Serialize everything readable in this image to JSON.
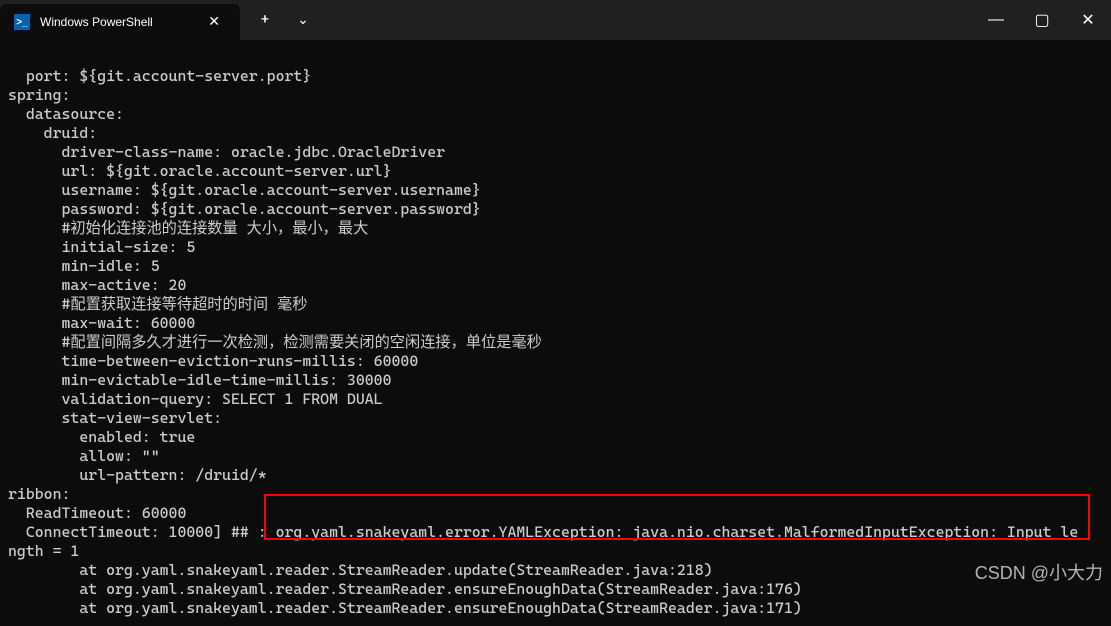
{
  "titlebar": {
    "tab_title": "Windows PowerShell",
    "tab_icon_glyph": ">_",
    "close_glyph": "✕",
    "add_glyph": "+",
    "dropdown_glyph": "⌄"
  },
  "window_controls": {
    "min": "—",
    "max": "▢",
    "close": "✕"
  },
  "terminal": {
    "lines": [
      "  port: ${git.account-server.port}",
      "spring:",
      "  datasource:",
      "    druid:",
      "      driver-class-name: oracle.jdbc.OracleDriver",
      "      url: ${git.oracle.account-server.url}",
      "      username: ${git.oracle.account-server.username}",
      "      password: ${git.oracle.account-server.password}",
      "      #初始化连接池的连接数量 大小，最小，最大",
      "      initial-size: 5",
      "      min-idle: 5",
      "      max-active: 20",
      "      #配置获取连接等待超时的时间 毫秒",
      "      max-wait: 60000",
      "      #配置间隔多久才进行一次检测，检测需要关闭的空闲连接，单位是毫秒",
      "      time-between-eviction-runs-millis: 60000",
      "      min-evictable-idle-time-millis: 30000",
      "      validation-query: SELECT 1 FROM DUAL",
      "      stat-view-servlet:",
      "        enabled: true",
      "        allow: \"\"",
      "        url-pattern: /druid/*",
      "ribbon:",
      "  ReadTimeout: 60000",
      "  ConnectTimeout: 10000] ## : org.yaml.snakeyaml.error.YAMLException: java.nio.charset.MalformedInputException: Input le",
      "ngth = 1",
      "        at org.yaml.snakeyaml.reader.StreamReader.update(StreamReader.java:218)",
      "        at org.yaml.snakeyaml.reader.StreamReader.ensureEnoughData(StreamReader.java:176)",
      "        at org.yaml.snakeyaml.reader.StreamReader.ensureEnoughData(StreamReader.java:171)"
    ]
  },
  "watermark": "CSDN @小大力"
}
